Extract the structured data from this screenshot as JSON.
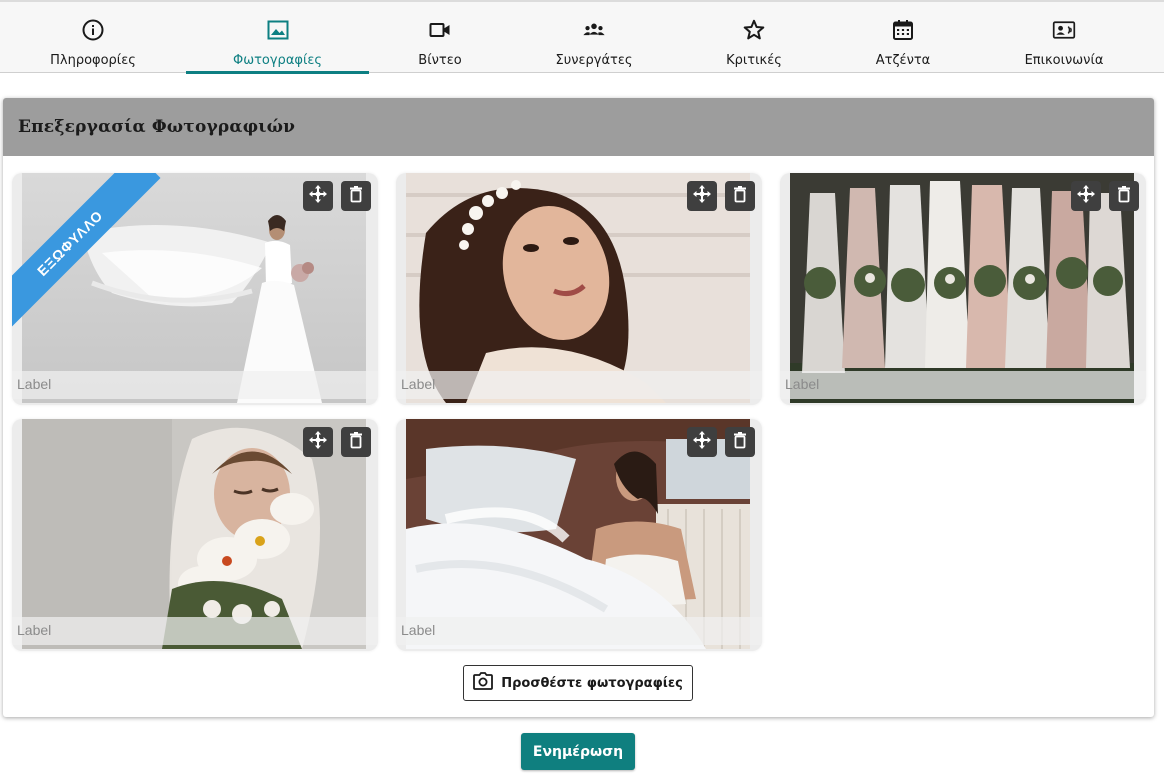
{
  "tabs": [
    {
      "label": "Πληροφορίες",
      "icon": "info-circle-icon"
    },
    {
      "label": "Φωτογραφίες",
      "icon": "image-icon",
      "active": true
    },
    {
      "label": "Βίντεο",
      "icon": "videocam-icon"
    },
    {
      "label": "Συνεργάτες",
      "icon": "group-icon"
    },
    {
      "label": "Κριτικές",
      "icon": "star-icon"
    },
    {
      "label": "Ατζέντα",
      "icon": "calendar-icon"
    },
    {
      "label": "Επικοινωνία",
      "icon": "contact-card-icon"
    }
  ],
  "editor": {
    "title": "Επεξεργασία Φωτογραφιών",
    "cover_badge": "ΕΞΩΦΥΛΛΟ",
    "photos": [
      {
        "label": "Label",
        "cover": true
      },
      {
        "label": "Label",
        "cover": false
      },
      {
        "label": "Label",
        "cover": false
      },
      {
        "label": "Label",
        "cover": false
      },
      {
        "label": "Label",
        "cover": false
      }
    ],
    "add_photos_label": "Προσθέστε φωτογραφίες"
  },
  "actions": {
    "update_label": "Ενημέρωση"
  },
  "colors": {
    "accent": "#0d7f82",
    "cover_badge": "#3a98df",
    "header_bg": "#9d9d9d"
  }
}
